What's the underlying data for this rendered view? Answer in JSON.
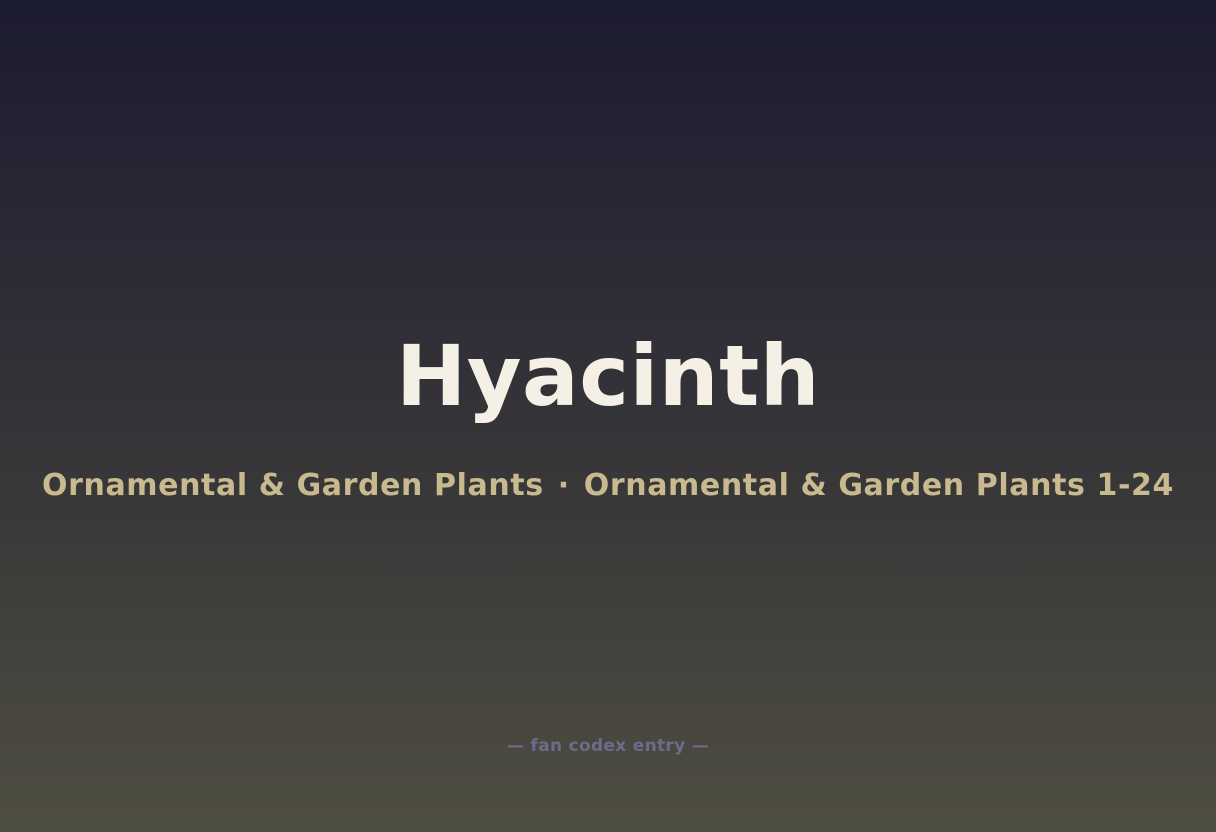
{
  "entry": {
    "title": "Hyacinth",
    "category": "Ornamental & Garden Plants",
    "separator": "·",
    "subcategory": "Ornamental & Garden Plants 1-24",
    "footer": "— fan codex entry —"
  },
  "colors": {
    "title": "#f5f0e6",
    "subtitle": "#c9b98f",
    "footer": "#6e6a8a",
    "background_top": "#1c1b30",
    "background_bottom": "#4f4e42"
  }
}
